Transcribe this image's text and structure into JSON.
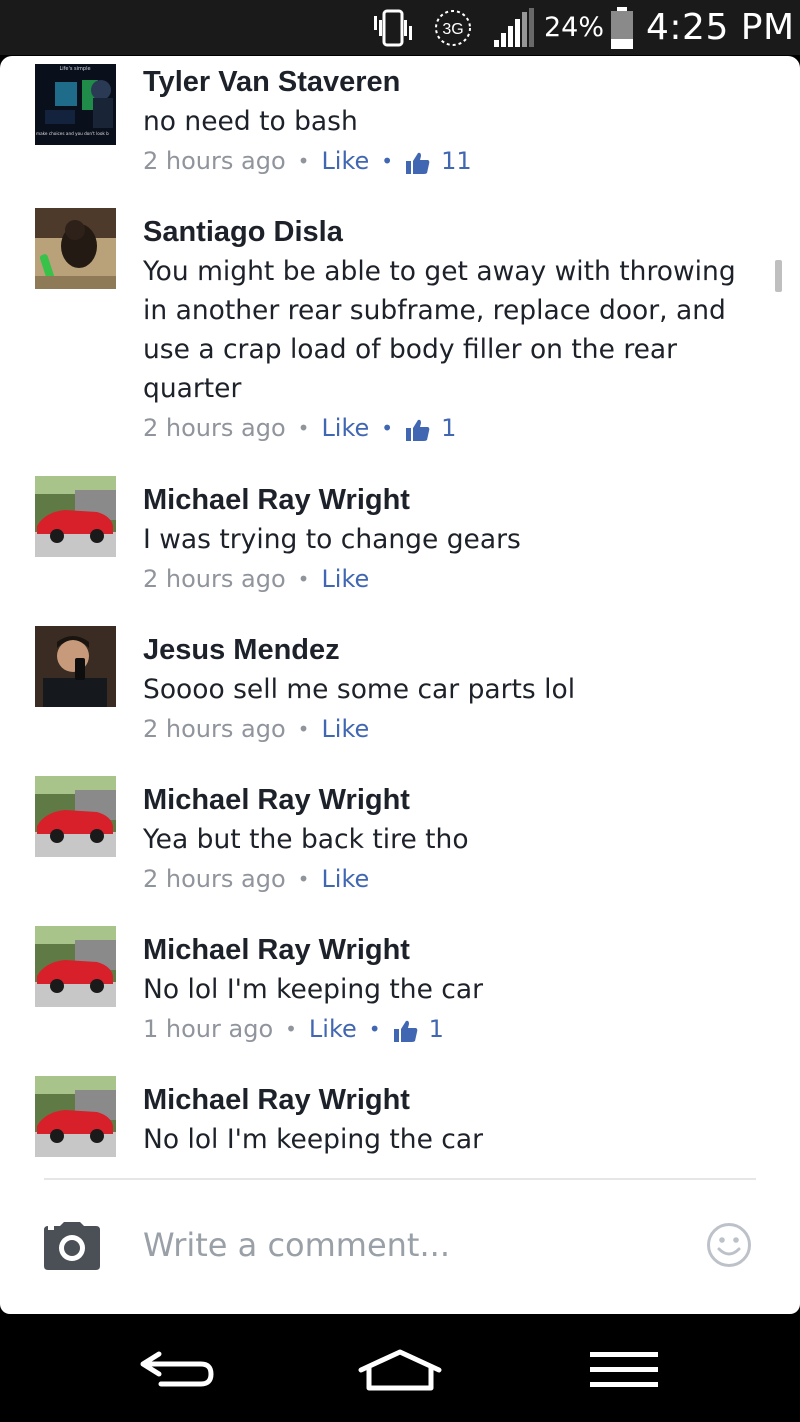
{
  "status_bar": {
    "battery_percent": "24%",
    "time": "4:25 PM",
    "network": "3G",
    "icons": [
      "vibrate-icon",
      "3g-data-icon",
      "signal-icon",
      "battery-icon"
    ]
  },
  "comments": [
    {
      "author": "Tyler Van Staveren",
      "text": "no need to bash",
      "time": "2 hours ago",
      "like_label": "Like",
      "like_count": "11",
      "avatar_text": [
        "Life's simple",
        "make choices and you don't look b"
      ]
    },
    {
      "author": "Santiago Disla",
      "text": "You might be able to get away with throwing in another rear subframe, replace door, and use a crap load of body filler on the rear quarter",
      "time": "2 hours ago",
      "like_label": "Like",
      "like_count": "1"
    },
    {
      "author": "Michael Ray Wright",
      "text": "I was trying to change gears",
      "time": "2 hours ago",
      "like_label": "Like"
    },
    {
      "author": "Jesus Mendez",
      "text": "Soooo sell me some car parts lol",
      "time": "2 hours ago",
      "like_label": "Like"
    },
    {
      "author": "Michael Ray Wright",
      "text": "Yea but the back tire tho",
      "time": "2 hours ago",
      "like_label": "Like"
    },
    {
      "author": "Michael Ray Wright",
      "text": "No lol I'm keeping the car",
      "time": "1 hour ago",
      "like_label": "Like",
      "like_count": "1"
    },
    {
      "author": "Michael Ray Wright",
      "text": "No lol I'm keeping the car"
    }
  ],
  "composer": {
    "placeholder": "Write a comment..."
  },
  "nav_bar": {
    "icons": [
      "back-icon",
      "home-icon",
      "menu-icon"
    ]
  },
  "colors": {
    "link_blue": "#4267b2",
    "meta_gray": "#90949c",
    "text_dark": "#1d2129",
    "car_red": "#d8202a"
  }
}
